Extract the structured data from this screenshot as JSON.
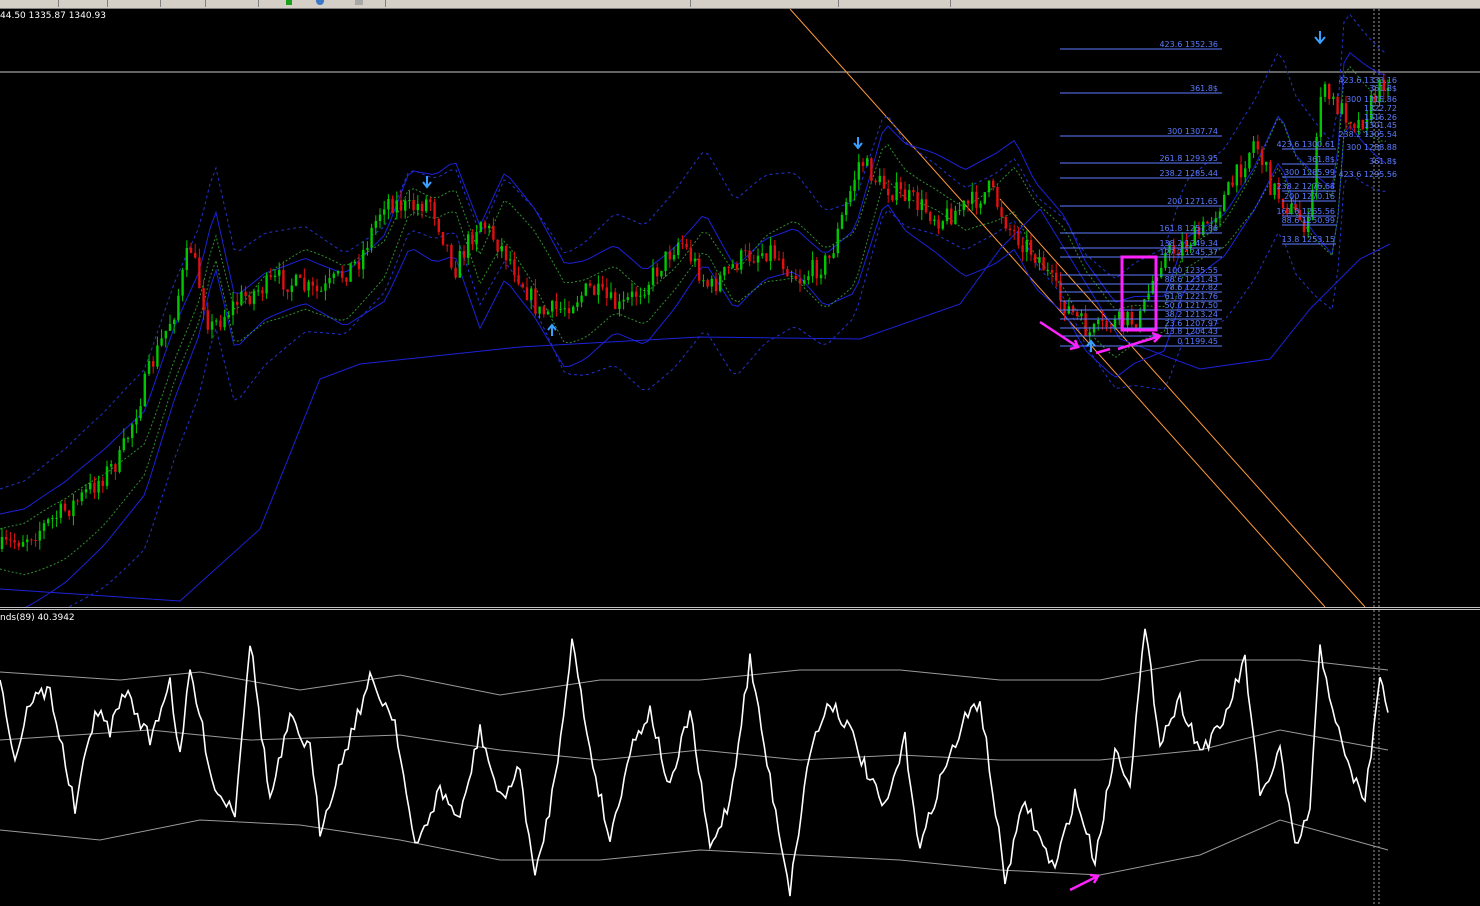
{
  "colors": {
    "background": "#000000",
    "bull_candle": "#00c800",
    "bear_candle": "#e01010",
    "bollinger_outer": "#1c22d8",
    "bollinger_inner": "#2233cc",
    "envelope_green": "#2f8f2f",
    "trendline": "#ff9a3c",
    "fibo": "#5b7bff",
    "marker": "#3aa0ff",
    "annotation": "#ff22ff",
    "oscillator": "#ffffff",
    "osc_bands": "#9a9a9a"
  },
  "main_chart": {
    "price_label": "44.50 1335.87 1340.93",
    "fibo_left": [
      {
        "label": "423.6 1352.36"
      },
      {
        "label": "361.8$"
      },
      {
        "label": "300 1307.74"
      },
      {
        "label": "261.8 1293.95"
      },
      {
        "label": "238.2 1285.44"
      },
      {
        "label": "200 1271.65"
      },
      {
        "label": "161.8 1257.86"
      },
      {
        "label": "138.2 1249.34"
      },
      {
        "label": "127.2 1245.37"
      },
      {
        "label": "100 1235.55"
      },
      {
        "label": "88.6 1231.43"
      },
      {
        "label": "78.6 1227.82"
      },
      {
        "label": "61.8 1221.76"
      },
      {
        "label": "50.0 1217.50"
      },
      {
        "label": "38.2 1213.24"
      },
      {
        "label": "23.6 1207.97"
      },
      {
        "label": "13.8 1204.43"
      },
      {
        "label": "0 1199.45"
      }
    ],
    "fibo_right": [
      {
        "label": "423.6 1300.61"
      },
      {
        "label": "361.8$"
      },
      {
        "label": "300 1285.99"
      },
      {
        "label": "238.2 1276.68"
      },
      {
        "label": "200 1270.16"
      },
      {
        "label": "161.8 1265.56"
      },
      {
        "label": "88.6 1250.99"
      },
      {
        "label": "13.8 1253.15"
      }
    ],
    "fibo_far": [
      {
        "label": "423.6 1333.16"
      },
      {
        "label": "361.8$"
      },
      {
        "label": "300 1315.86"
      },
      {
        "label": "238.2 1305.54"
      },
      {
        "label": "300 1288.88"
      },
      {
        "label": "361.8$"
      },
      {
        "label": "423.6 1295.56"
      }
    ],
    "truncated_labels": [
      {
        "label": "1322.72"
      },
      {
        "label": "1316.26"
      },
      {
        "label": "1301.45"
      }
    ]
  },
  "sub_chart": {
    "indicator_label": "nds(89) 40.3942"
  }
}
